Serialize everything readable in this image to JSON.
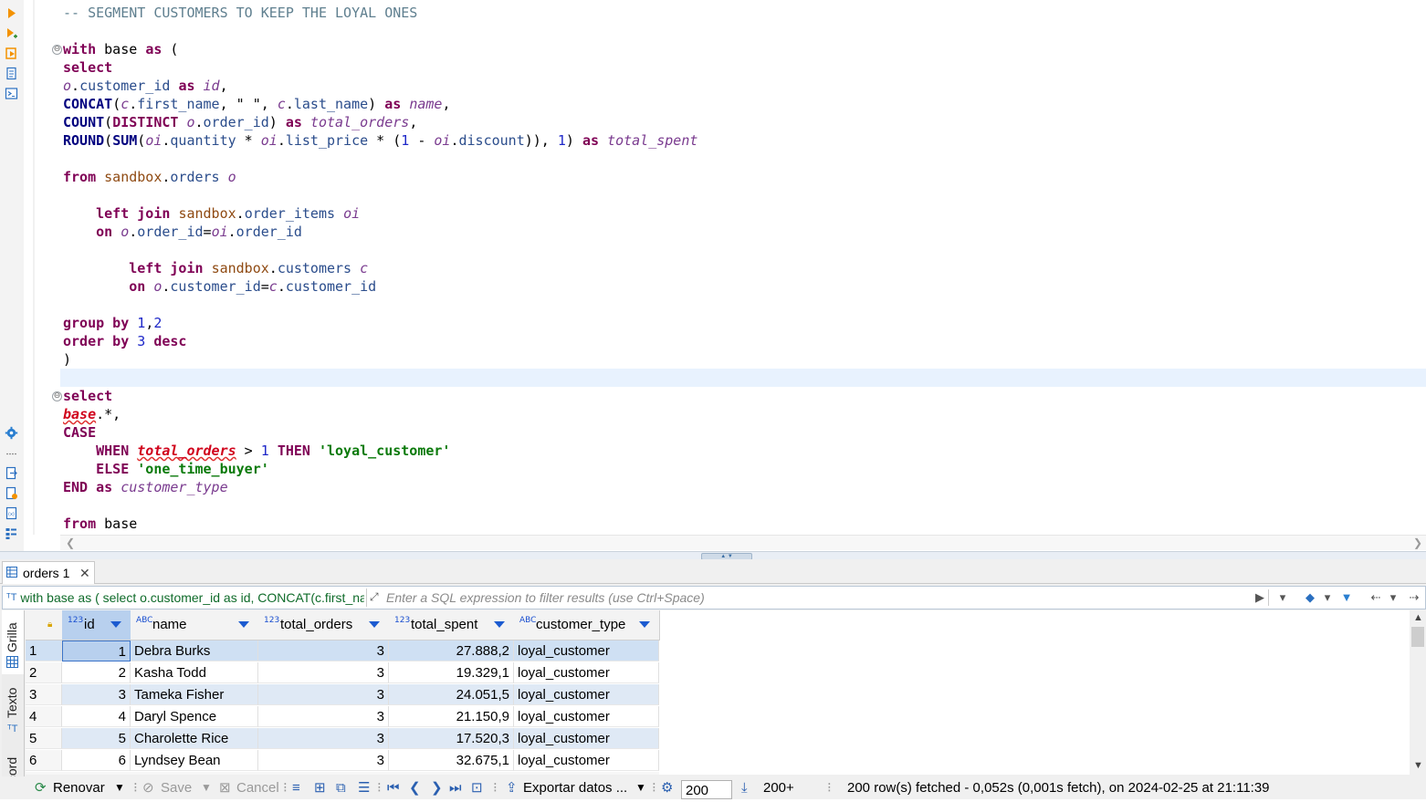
{
  "editor": {
    "code_lines": [
      {
        "line": 1,
        "tokens": [
          {
            "c": "cmt",
            "t": "-- SEGMENT CUSTOMERS TO KEEP THE LOYAL ONES"
          }
        ]
      },
      {
        "line": 3,
        "tokens": [
          {
            "c": "kw",
            "t": "with"
          },
          {
            "c": "op",
            "t": " base "
          },
          {
            "c": "kw",
            "t": "as"
          },
          {
            "c": "op",
            "t": " ("
          }
        ]
      },
      {
        "line": 4,
        "tokens": [
          {
            "c": "kw",
            "t": "select"
          }
        ]
      },
      {
        "line": 5,
        "tokens": [
          {
            "c": "al",
            "t": "o"
          },
          {
            "c": "op",
            "t": "."
          },
          {
            "c": "col",
            "t": "customer_id"
          },
          {
            "c": "op",
            "t": " "
          },
          {
            "c": "kw",
            "t": "as"
          },
          {
            "c": "op",
            "t": " "
          },
          {
            "c": "al",
            "t": "id"
          },
          {
            "c": "op",
            "t": ","
          }
        ]
      },
      {
        "line": 6,
        "tokens": [
          {
            "c": "fn",
            "t": "CONCAT"
          },
          {
            "c": "op",
            "t": "("
          },
          {
            "c": "al",
            "t": "c"
          },
          {
            "c": "op",
            "t": "."
          },
          {
            "c": "col",
            "t": "first_name"
          },
          {
            "c": "op",
            "t": ", \" \", "
          },
          {
            "c": "al",
            "t": "c"
          },
          {
            "c": "op",
            "t": "."
          },
          {
            "c": "col",
            "t": "last_name"
          },
          {
            "c": "op",
            "t": ") "
          },
          {
            "c": "kw",
            "t": "as"
          },
          {
            "c": "op",
            "t": " "
          },
          {
            "c": "al",
            "t": "name"
          },
          {
            "c": "op",
            "t": ","
          }
        ]
      },
      {
        "line": 7,
        "tokens": [
          {
            "c": "fn",
            "t": "COUNT"
          },
          {
            "c": "op",
            "t": "("
          },
          {
            "c": "kw",
            "t": "DISTINCT"
          },
          {
            "c": "op",
            "t": " "
          },
          {
            "c": "al",
            "t": "o"
          },
          {
            "c": "op",
            "t": "."
          },
          {
            "c": "col",
            "t": "order_id"
          },
          {
            "c": "op",
            "t": ") "
          },
          {
            "c": "kw",
            "t": "as"
          },
          {
            "c": "op",
            "t": " "
          },
          {
            "c": "al",
            "t": "total_orders"
          },
          {
            "c": "op",
            "t": ","
          }
        ]
      },
      {
        "line": 8,
        "tokens": [
          {
            "c": "fn",
            "t": "ROUND"
          },
          {
            "c": "op",
            "t": "("
          },
          {
            "c": "fn",
            "t": "SUM"
          },
          {
            "c": "op",
            "t": "("
          },
          {
            "c": "al",
            "t": "oi"
          },
          {
            "c": "op",
            "t": "."
          },
          {
            "c": "col",
            "t": "quantity"
          },
          {
            "c": "op",
            "t": " * "
          },
          {
            "c": "al",
            "t": "oi"
          },
          {
            "c": "op",
            "t": "."
          },
          {
            "c": "col",
            "t": "list_price"
          },
          {
            "c": "op",
            "t": " * ("
          },
          {
            "c": "num",
            "t": "1"
          },
          {
            "c": "op",
            "t": " - "
          },
          {
            "c": "al",
            "t": "oi"
          },
          {
            "c": "op",
            "t": "."
          },
          {
            "c": "col",
            "t": "discount"
          },
          {
            "c": "op",
            "t": ")), "
          },
          {
            "c": "num",
            "t": "1"
          },
          {
            "c": "op",
            "t": ") "
          },
          {
            "c": "kw",
            "t": "as"
          },
          {
            "c": "op",
            "t": " "
          },
          {
            "c": "al",
            "t": "total_spent"
          }
        ]
      },
      {
        "line": 10,
        "tokens": [
          {
            "c": "kw",
            "t": "from"
          },
          {
            "c": "op",
            "t": " "
          },
          {
            "c": "tbl",
            "t": "sandbox"
          },
          {
            "c": "op",
            "t": "."
          },
          {
            "c": "col",
            "t": "orders"
          },
          {
            "c": "op",
            "t": " "
          },
          {
            "c": "al",
            "t": "o"
          }
        ]
      },
      {
        "line": 12,
        "tokens": [
          {
            "c": "op",
            "t": "    "
          },
          {
            "c": "kw",
            "t": "left join"
          },
          {
            "c": "op",
            "t": " "
          },
          {
            "c": "tbl",
            "t": "sandbox"
          },
          {
            "c": "op",
            "t": "."
          },
          {
            "c": "col",
            "t": "order_items"
          },
          {
            "c": "op",
            "t": " "
          },
          {
            "c": "al",
            "t": "oi"
          }
        ]
      },
      {
        "line": 13,
        "tokens": [
          {
            "c": "op",
            "t": "    "
          },
          {
            "c": "kw",
            "t": "on"
          },
          {
            "c": "op",
            "t": " "
          },
          {
            "c": "al",
            "t": "o"
          },
          {
            "c": "op",
            "t": "."
          },
          {
            "c": "col",
            "t": "order_id"
          },
          {
            "c": "op",
            "t": "="
          },
          {
            "c": "al",
            "t": "oi"
          },
          {
            "c": "op",
            "t": "."
          },
          {
            "c": "col",
            "t": "order_id"
          }
        ]
      },
      {
        "line": 15,
        "tokens": [
          {
            "c": "op",
            "t": "        "
          },
          {
            "c": "kw",
            "t": "left join"
          },
          {
            "c": "op",
            "t": " "
          },
          {
            "c": "tbl",
            "t": "sandbox"
          },
          {
            "c": "op",
            "t": "."
          },
          {
            "c": "col",
            "t": "customers"
          },
          {
            "c": "op",
            "t": " "
          },
          {
            "c": "al",
            "t": "c"
          }
        ]
      },
      {
        "line": 16,
        "tokens": [
          {
            "c": "op",
            "t": "        "
          },
          {
            "c": "kw",
            "t": "on"
          },
          {
            "c": "op",
            "t": " "
          },
          {
            "c": "al",
            "t": "o"
          },
          {
            "c": "op",
            "t": "."
          },
          {
            "c": "col",
            "t": "customer_id"
          },
          {
            "c": "op",
            "t": "="
          },
          {
            "c": "al",
            "t": "c"
          },
          {
            "c": "op",
            "t": "."
          },
          {
            "c": "col",
            "t": "customer_id"
          }
        ]
      },
      {
        "line": 18,
        "tokens": [
          {
            "c": "kw",
            "t": "group by"
          },
          {
            "c": "op",
            "t": " "
          },
          {
            "c": "num",
            "t": "1"
          },
          {
            "c": "op",
            "t": ","
          },
          {
            "c": "num",
            "t": "2"
          }
        ]
      },
      {
        "line": 19,
        "tokens": [
          {
            "c": "kw",
            "t": "order by"
          },
          {
            "c": "op",
            "t": " "
          },
          {
            "c": "num",
            "t": "3"
          },
          {
            "c": "op",
            "t": " "
          },
          {
            "c": "kw",
            "t": "desc"
          }
        ]
      },
      {
        "line": 20,
        "tokens": [
          {
            "c": "op",
            "t": ")"
          }
        ]
      },
      {
        "line": 22,
        "tokens": [
          {
            "c": "kw",
            "t": "select"
          }
        ]
      },
      {
        "line": 23,
        "tokens": [
          {
            "c": "err",
            "t": "base"
          },
          {
            "c": "op",
            "t": ".*,"
          }
        ]
      },
      {
        "line": 24,
        "tokens": [
          {
            "c": "kw",
            "t": "CASE"
          }
        ]
      },
      {
        "line": 25,
        "tokens": [
          {
            "c": "op",
            "t": "    "
          },
          {
            "c": "kw",
            "t": "WHEN"
          },
          {
            "c": "op",
            "t": " "
          },
          {
            "c": "err",
            "t": "total_orders"
          },
          {
            "c": "op",
            "t": " > "
          },
          {
            "c": "num",
            "t": "1"
          },
          {
            "c": "op",
            "t": " "
          },
          {
            "c": "kw",
            "t": "THEN"
          },
          {
            "c": "op",
            "t": " "
          },
          {
            "c": "str",
            "t": "'loyal_customer'"
          }
        ]
      },
      {
        "line": 26,
        "tokens": [
          {
            "c": "op",
            "t": "    "
          },
          {
            "c": "kw",
            "t": "ELSE"
          },
          {
            "c": "op",
            "t": " "
          },
          {
            "c": "str",
            "t": "'one_time_buyer'"
          }
        ]
      },
      {
        "line": 27,
        "tokens": [
          {
            "c": "kw",
            "t": "END"
          },
          {
            "c": "op",
            "t": " "
          },
          {
            "c": "kw",
            "t": "as"
          },
          {
            "c": "op",
            "t": " "
          },
          {
            "c": "al",
            "t": "customer_type"
          }
        ]
      },
      {
        "line": 29,
        "tokens": [
          {
            "c": "kw",
            "t": "from"
          },
          {
            "c": "op",
            "t": " base"
          }
        ]
      }
    ],
    "fold_markers": [
      3,
      22
    ]
  },
  "results": {
    "tab_label": "orders 1",
    "tab_close": "✕",
    "query_preview": "with base as ( select o.customer_id as id, CONCAT(c.first_name, \" \", c.last_name) as name,",
    "filter_placeholder": "Enter a SQL expression to filter results (use Ctrl+Space)",
    "side_tabs": [
      "Grilla",
      "Texto",
      "Record"
    ],
    "columns": [
      {
        "type": "123",
        "label": "id"
      },
      {
        "type": "ABC",
        "label": "name"
      },
      {
        "type": "123",
        "label": "total_orders"
      },
      {
        "type": "123",
        "label": "total_spent"
      },
      {
        "type": "ABC",
        "label": "customer_type"
      }
    ],
    "rows": [
      {
        "n": "1",
        "id": "1",
        "name": "Debra Burks",
        "total_orders": "3",
        "total_spent": "27.888,2",
        "customer_type": "loyal_customer"
      },
      {
        "n": "2",
        "id": "2",
        "name": "Kasha Todd",
        "total_orders": "3",
        "total_spent": "19.329,1",
        "customer_type": "loyal_customer"
      },
      {
        "n": "3",
        "id": "3",
        "name": "Tameka Fisher",
        "total_orders": "3",
        "total_spent": "24.051,5",
        "customer_type": "loyal_customer"
      },
      {
        "n": "4",
        "id": "4",
        "name": "Daryl Spence",
        "total_orders": "3",
        "total_spent": "21.150,9",
        "customer_type": "loyal_customer"
      },
      {
        "n": "5",
        "id": "5",
        "name": "Charolette Rice",
        "total_orders": "3",
        "total_spent": "17.520,3",
        "customer_type": "loyal_customer"
      },
      {
        "n": "6",
        "id": "6",
        "name": "Lyndsey Bean",
        "total_orders": "3",
        "total_spent": "32.675,1",
        "customer_type": "loyal_customer"
      }
    ]
  },
  "bottombar": {
    "refresh_label": "Renovar",
    "save_label": "Save",
    "cancel_label": "Cancel",
    "export_label": "Exportar datos ...",
    "fetch_size": "200",
    "fetch_more_label": "200+",
    "status": "200 row(s) fetched - 0,052s (0,001s fetch), on 2024-02-25 at 21:11:39"
  },
  "colors": {
    "keyword": "#7f0055",
    "string": "#0b7a0b",
    "number": "#1d27c8",
    "error": "#d0021b",
    "selection": "#b8d0ee",
    "current_line": "#e8f2fe"
  }
}
